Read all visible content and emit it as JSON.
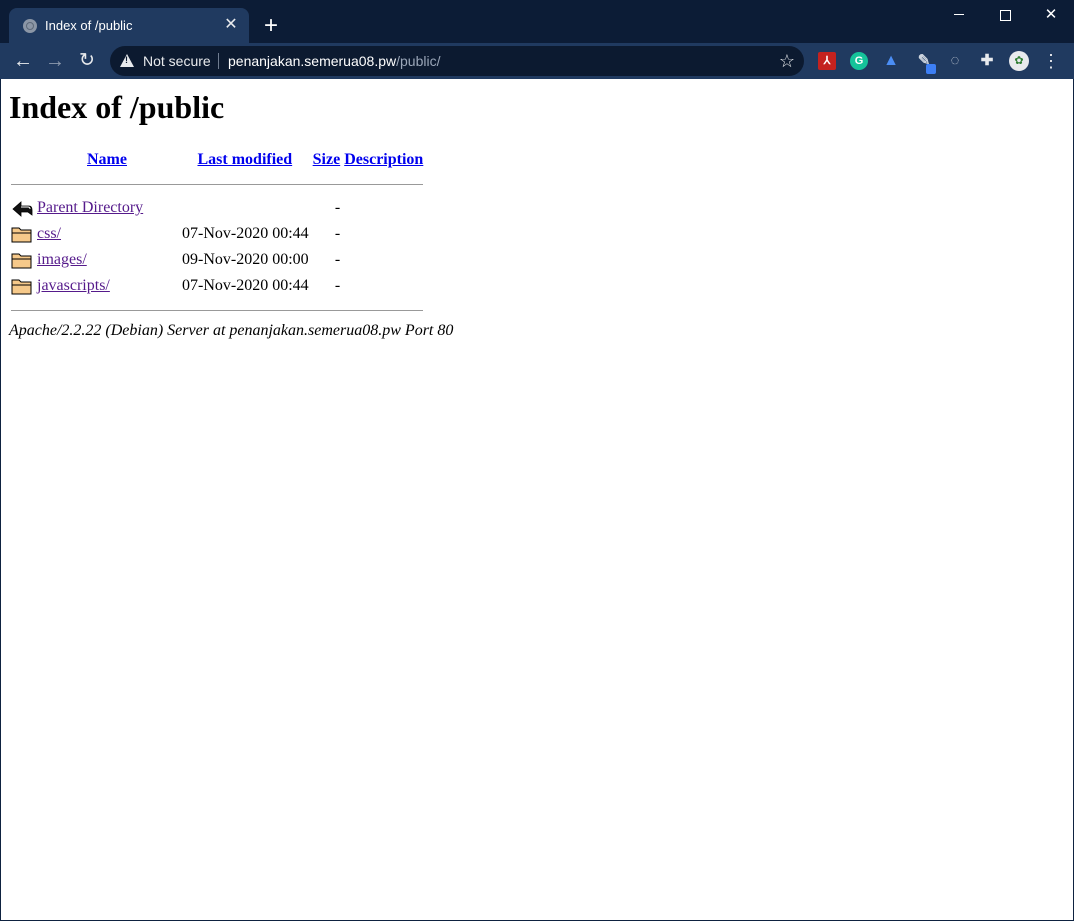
{
  "browser": {
    "tab": {
      "title": "Index of /public"
    },
    "address": {
      "security_label": "Not secure",
      "host": "penanjakan.semerua08.pw",
      "path": "/public/"
    },
    "extensions": [
      "adobe-acrobat",
      "grammarly",
      "graduation-cap",
      "pen-tool",
      "sync",
      "extensions-puzzle"
    ],
    "accent_colors": {
      "titlebar": "#0c1c36",
      "toolbar": "#203a60",
      "omnibox": "#0c1a30"
    }
  },
  "page": {
    "title": "Index of /public",
    "columns": {
      "name": "Name",
      "last_modified": "Last modified",
      "size": "Size",
      "description": "Description"
    },
    "rows": [
      {
        "icon": "back-arrow",
        "name": "Parent Directory",
        "modified": "",
        "size": "-"
      },
      {
        "icon": "folder",
        "name": "css/",
        "modified": "07-Nov-2020 00:44",
        "size": "-"
      },
      {
        "icon": "folder",
        "name": "images/",
        "modified": "09-Nov-2020 00:00",
        "size": "-"
      },
      {
        "icon": "folder",
        "name": "javascripts/",
        "modified": "07-Nov-2020 00:44",
        "size": "-"
      }
    ],
    "server_signature": "Apache/2.2.22 (Debian) Server at penanjakan.semerua08.pw Port 80"
  }
}
